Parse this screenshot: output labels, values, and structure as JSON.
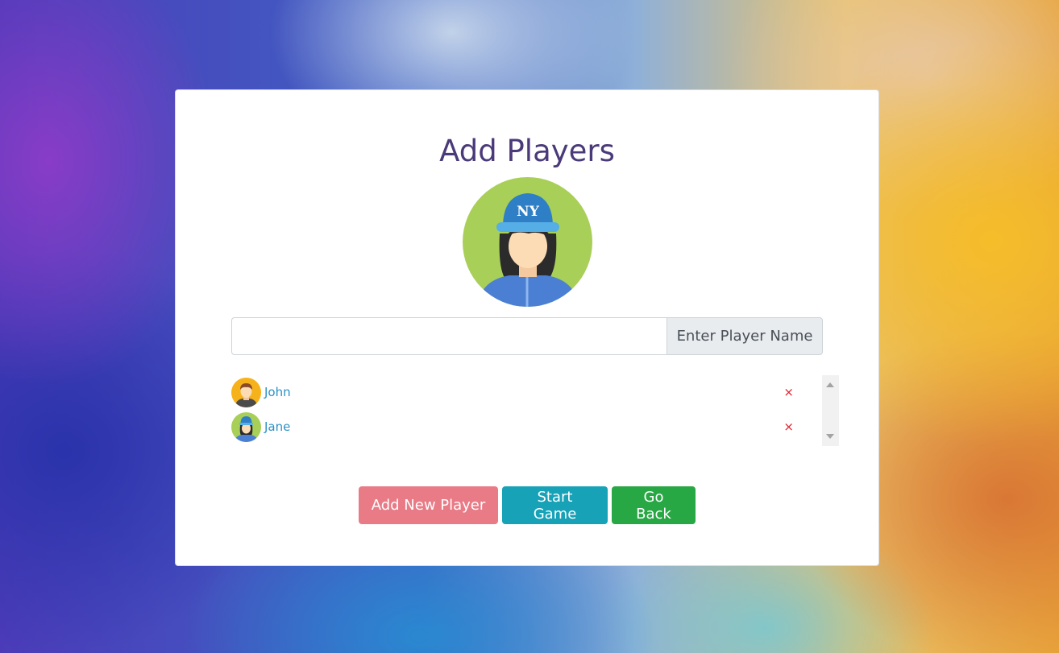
{
  "page": {
    "title": "Add Players"
  },
  "selected_avatar": {
    "icon": "player-avatar-ny-cap-icon",
    "cap_text": "NY"
  },
  "input": {
    "value": "",
    "addon_label": "Enter Player Name"
  },
  "players": [
    {
      "name": "John",
      "avatar": "boy-avatar-icon",
      "remove": "×"
    },
    {
      "name": "Jane",
      "avatar": "girl-ny-cap-avatar-icon",
      "remove": "×"
    }
  ],
  "buttons": {
    "add_new": "Add New Player",
    "start": "Start Game",
    "back": "Go Back"
  },
  "colors": {
    "title": "#4b3a7a",
    "add_button": "#e97b86",
    "start_button": "#17a2b8",
    "back_button": "#28a745",
    "player_name": "#2a92c5",
    "remove": "#e0202a"
  }
}
